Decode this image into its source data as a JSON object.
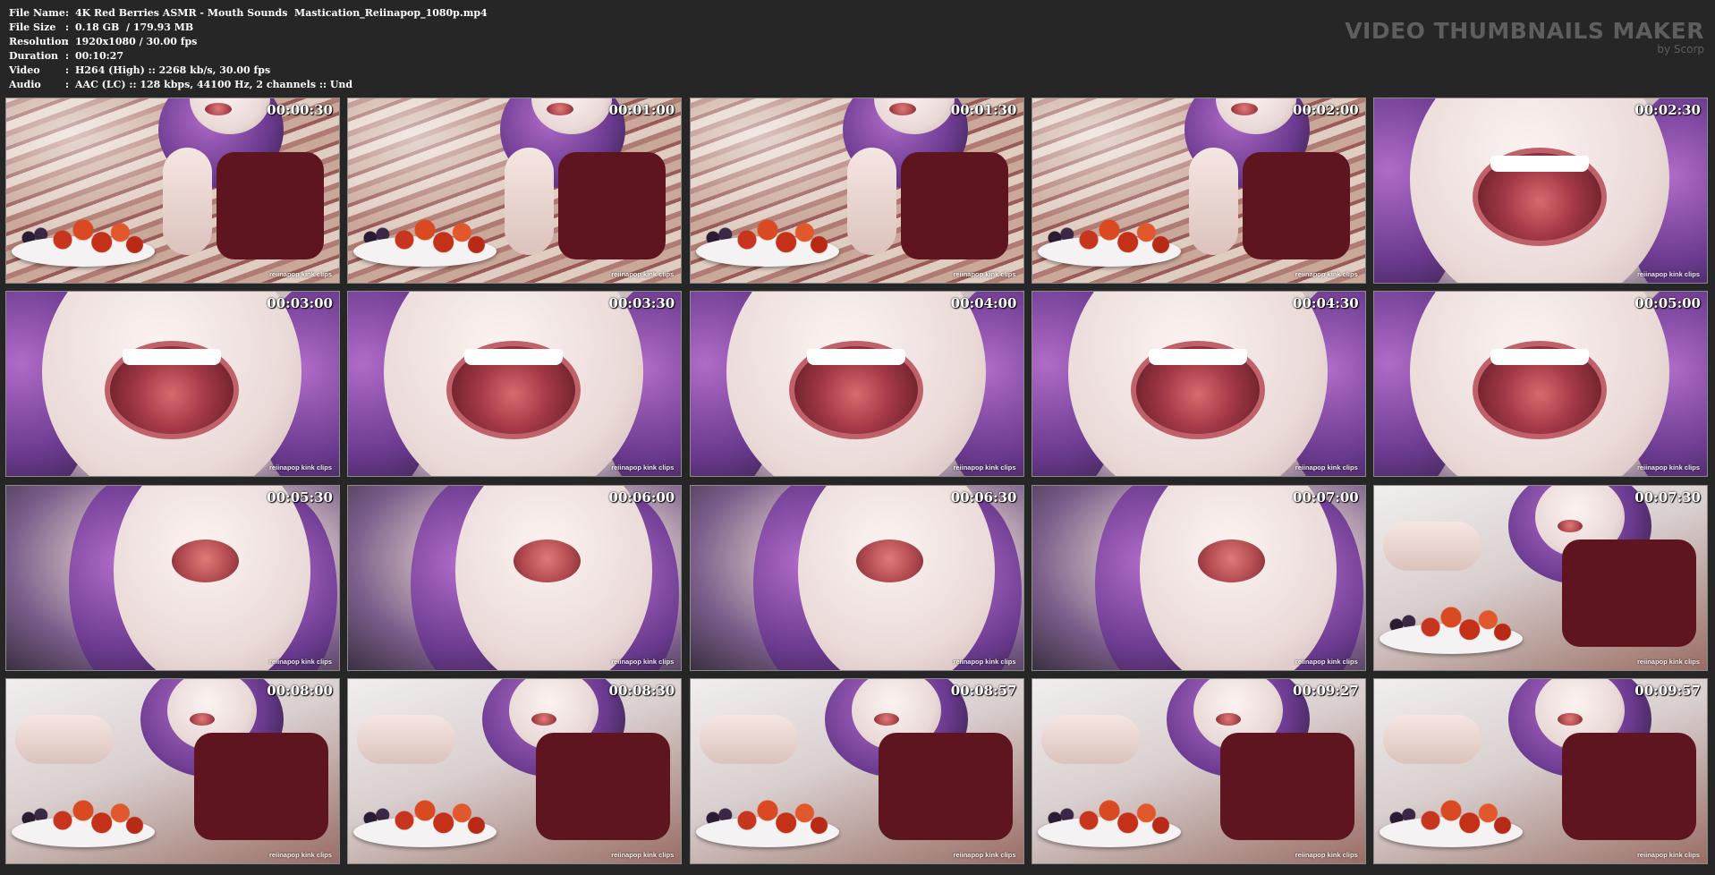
{
  "header": {
    "fields": [
      {
        "label": "File Name",
        "value": "4K Red Berries ASMR - Mouth Sounds  Mastication_Reiinapop_1080p.mp4"
      },
      {
        "label": "File Size",
        "value": "0.18 GB  / 179.93 MB"
      },
      {
        "label": "Resolution",
        "value": "1920x1080 / 30.00 fps"
      },
      {
        "label": "Duration",
        "value": "00:10:27"
      },
      {
        "label": "Video",
        "value": "H264 (High) :: 2268 kb/s, 30.00 fps"
      },
      {
        "label": "Audio",
        "value": "AAC (LC) :: 128 kbps, 44100 Hz, 2 channels :: Und"
      }
    ],
    "separator": ":"
  },
  "brand": {
    "title": "VIDEO THUMBNAILS MAKER",
    "byline": "by Scorp"
  },
  "colors": {
    "background": "#262626",
    "text": "#ffffff",
    "brand": "#5e5e5e"
  },
  "watermark": "reiinapop kink clips",
  "thumbnails": [
    {
      "time": "00:00:30",
      "scene": "bed"
    },
    {
      "time": "00:01:00",
      "scene": "bed"
    },
    {
      "time": "00:01:30",
      "scene": "bed"
    },
    {
      "time": "00:02:00",
      "scene": "bed"
    },
    {
      "time": "00:02:30",
      "scene": "close"
    },
    {
      "time": "00:03:00",
      "scene": "close"
    },
    {
      "time": "00:03:30",
      "scene": "close"
    },
    {
      "time": "00:04:00",
      "scene": "close"
    },
    {
      "time": "00:04:30",
      "scene": "close"
    },
    {
      "time": "00:05:00",
      "scene": "close"
    },
    {
      "time": "00:05:30",
      "scene": "side"
    },
    {
      "time": "00:06:00",
      "scene": "side"
    },
    {
      "time": "00:06:30",
      "scene": "side"
    },
    {
      "time": "00:07:00",
      "scene": "side"
    },
    {
      "time": "00:07:30",
      "scene": "tilt"
    },
    {
      "time": "00:08:00",
      "scene": "tilt"
    },
    {
      "time": "00:08:30",
      "scene": "tilt"
    },
    {
      "time": "00:08:57",
      "scene": "tilt"
    },
    {
      "time": "00:09:27",
      "scene": "tilt"
    },
    {
      "time": "00:09:57",
      "scene": "tilt"
    }
  ]
}
